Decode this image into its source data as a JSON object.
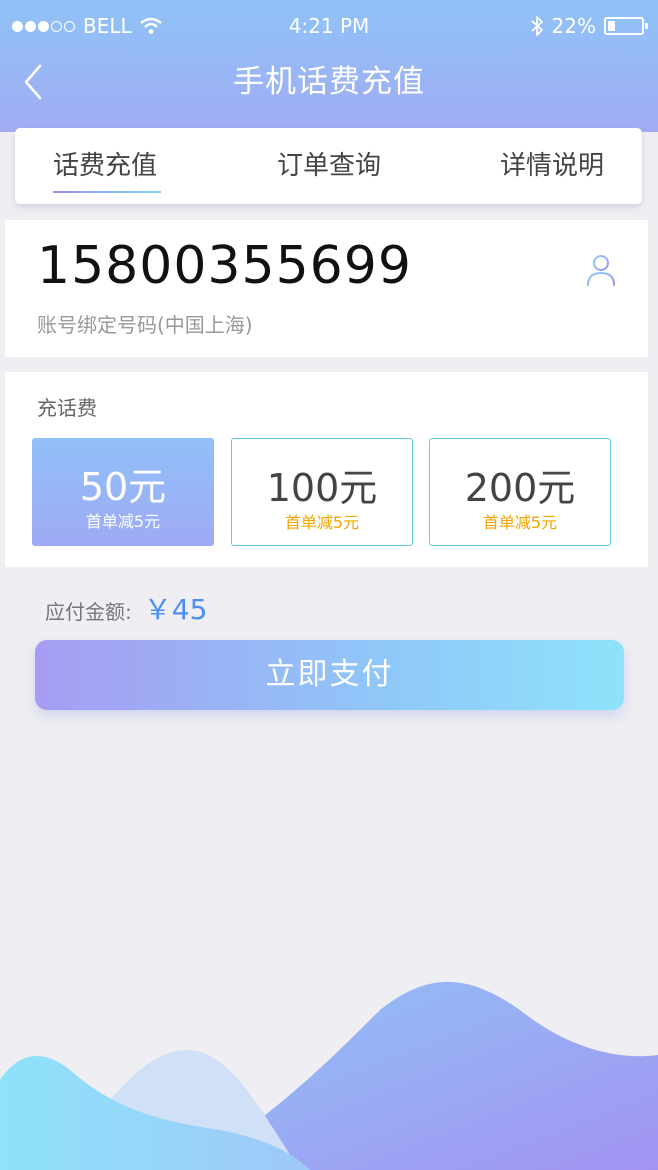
{
  "status_bar": {
    "carrier": "BELL",
    "time": "4:21 PM",
    "battery": "22%",
    "battery_level": 0.22
  },
  "nav": {
    "title": "手机话费充值",
    "back_icon": "chevron-left-icon"
  },
  "tabs": [
    {
      "label": "话费充值",
      "active": true
    },
    {
      "label": "订单查询",
      "active": false
    },
    {
      "label": "详情说明",
      "active": false
    }
  ],
  "phone": {
    "number": "15800355699",
    "subtitle": "账号绑定号码(中国上海)",
    "contact_icon": "person-icon"
  },
  "recharge": {
    "label": "充话费",
    "options": [
      {
        "value": "50元",
        "promo": "首单减5元",
        "selected": true
      },
      {
        "value": "100元",
        "promo": "首单减5元",
        "selected": false
      },
      {
        "value": "200元",
        "promo": "首单减5元",
        "selected": false
      }
    ]
  },
  "payment": {
    "label": "应付金额:",
    "amount": "￥45",
    "button_label": "立即支付"
  },
  "colors": {
    "header_gradient_top": "#8fc3f7",
    "header_gradient_bottom": "#a1abf3",
    "accent_blue": "#4d8ff0",
    "promo_orange": "#f5a400",
    "option_border": "#5fc9df"
  }
}
